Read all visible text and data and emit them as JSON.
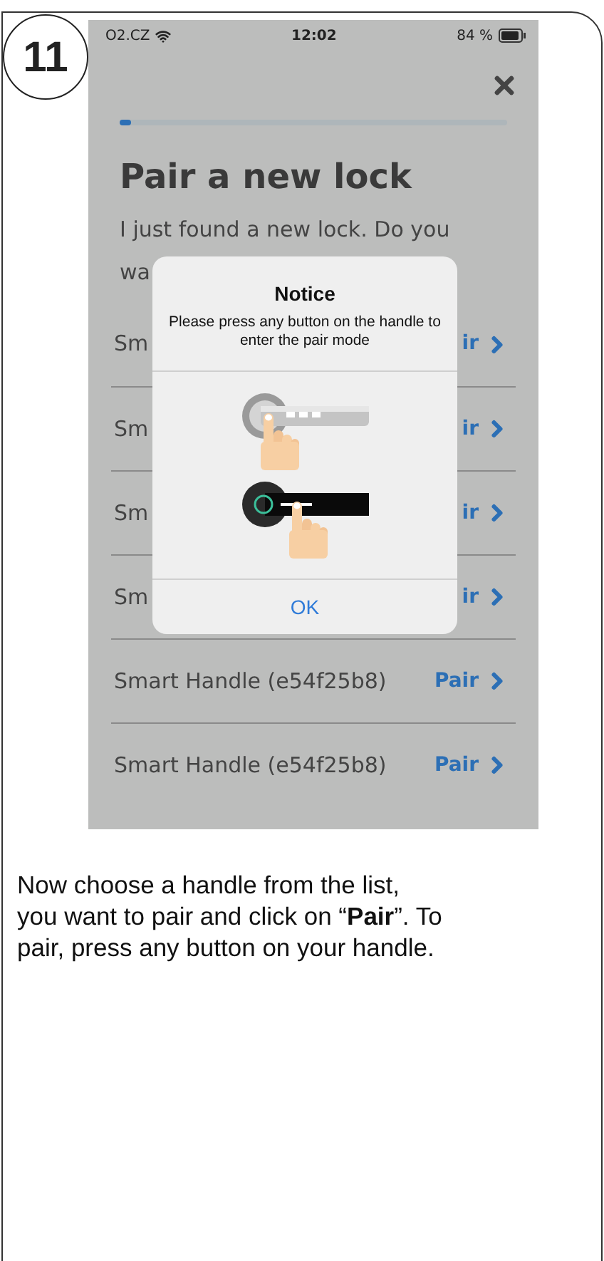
{
  "step": "11",
  "status_bar": {
    "carrier": "O2.CZ",
    "time": "12:02",
    "battery": "84 %"
  },
  "progress": {
    "level": 0.03
  },
  "title": "Pair a new lock",
  "subtitle_lines": [
    "I just found a new lock. Do you",
    "wa"
  ],
  "locks": [
    {
      "name": "Sm",
      "action": "ir"
    },
    {
      "name": "Sm",
      "action": "ir"
    },
    {
      "name": "Sm",
      "action": "ir"
    },
    {
      "name": "Sm",
      "action": "ir"
    },
    {
      "name": "Smart Handle (e54f25b8)",
      "action": "Pair"
    },
    {
      "name": "Smart Handle (e54f25b8)",
      "action": "Pair"
    }
  ],
  "dialog": {
    "title": "Notice",
    "message": "Please press any button on the handle to enter the pair mode",
    "button": "OK"
  },
  "instructions": "Now choose a handle from the list,\nyou want to pair and click on “**Pair**”. To\npair, press any button on your handle."
}
